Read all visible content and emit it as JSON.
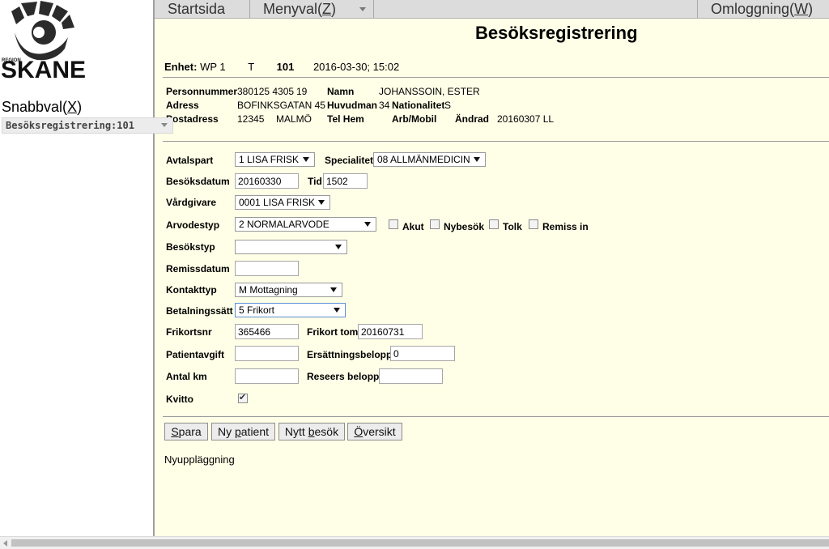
{
  "sidebar": {
    "logo_region": "REGION",
    "logo_name": "SKANE",
    "snabbval_label_pre": "Snabbval(",
    "snabbval_key": "X",
    "snabbval_label_post": ")",
    "snabbval_selected": "Besöksregistrering:101"
  },
  "topbar": {
    "startsida": "Startsida",
    "menyval_pre": "Menyval(",
    "menyval_key": "Z",
    "menyval_post": ")",
    "omloggning_pre": "Omloggning(",
    "omloggning_key": "W",
    "omloggning_post": ")"
  },
  "page": {
    "title": "Besöksregistrering",
    "unit_label": "Enhet:",
    "unit_value": "WP 1",
    "unit_code": "T",
    "unit_number": "101",
    "datetime": "2016-03-30; 15:02"
  },
  "patient": {
    "personnummer_label": "Personnummer",
    "personnummer_value": "380125 4305",
    "personnummer_extra": "19",
    "namn_label": "Namn",
    "namn_value": "JOHANSSOIN, ESTER",
    "adress_label": "Adress",
    "adress_value": "BOFINKSGATAN 45",
    "huvudman_label": "Huvudman",
    "huvudman_value": "34",
    "nationalitet_label": "Nationalitet",
    "nationalitet_value": "S",
    "postadress_label": "Postadress",
    "postnr_value": "12345",
    "postort_value": "MALMÖ",
    "telhem_label": "Tel Hem",
    "arbmobil_label": "Arb/Mobil",
    "andrad_label": "Ändrad",
    "andrad_value": "20160307 LL"
  },
  "form": {
    "avtalspart_label": "Avtalspart",
    "avtalspart_value": "1 LISA FRISK",
    "specialitet_label": "Specialitet",
    "specialitet_value": "08 ALLMÄNMEDICIN",
    "besoksdatum_label": "Besöksdatum",
    "besoksdatum_value": "20160330",
    "tid_label": "Tid",
    "tid_value": "1502",
    "vardgivare_label": "Vårdgivare",
    "vardgivare_value": "0001 LISA FRISK",
    "arvodestyp_label": "Arvodestyp",
    "arvodestyp_value": "2 NORMALARVODE",
    "akut_label": "Akut",
    "nybesok_label": "Nybesök",
    "tolk_label": "Tolk",
    "remiss_label": "Remiss in",
    "besokstyp_label": "Besökstyp",
    "besokstyp_value": "",
    "remissdatum_label": "Remissdatum",
    "remissdatum_value": "",
    "kontakttyp_label": "Kontakttyp",
    "kontakttyp_value": "M Mottagning",
    "betalningssatt_label": "Betalningssätt",
    "betalningssatt_value": "5 Frikort",
    "frikortsnr_label": "Frikortsnr",
    "frikortsnr_value": "365466",
    "frikort_tom_label": "Frikort tom",
    "frikort_tom_value": "20160731",
    "patientavgift_label": "Patientavgift",
    "patientavgift_value": "",
    "ersattning_label": "Ersättningsbelopp",
    "ersattning_value": "0",
    "antal_km_label": "Antal km",
    "antal_km_value": "",
    "reseers_label": "Reseers belopp",
    "reseers_value": "",
    "kvitto_label": "Kvitto",
    "kvitto_checked": true
  },
  "buttons": {
    "spara_key": "S",
    "spara_rest": "para",
    "nypatient_pre": "Ny ",
    "nypatient_key": "p",
    "nypatient_rest": "atient",
    "nyttbesok_pre": "Nytt ",
    "nyttbesok_key": "b",
    "nyttbesok_rest": "esök",
    "oversikt_key": "Ö",
    "oversikt_rest": "versikt"
  },
  "status_text": "Nyuppläggning"
}
